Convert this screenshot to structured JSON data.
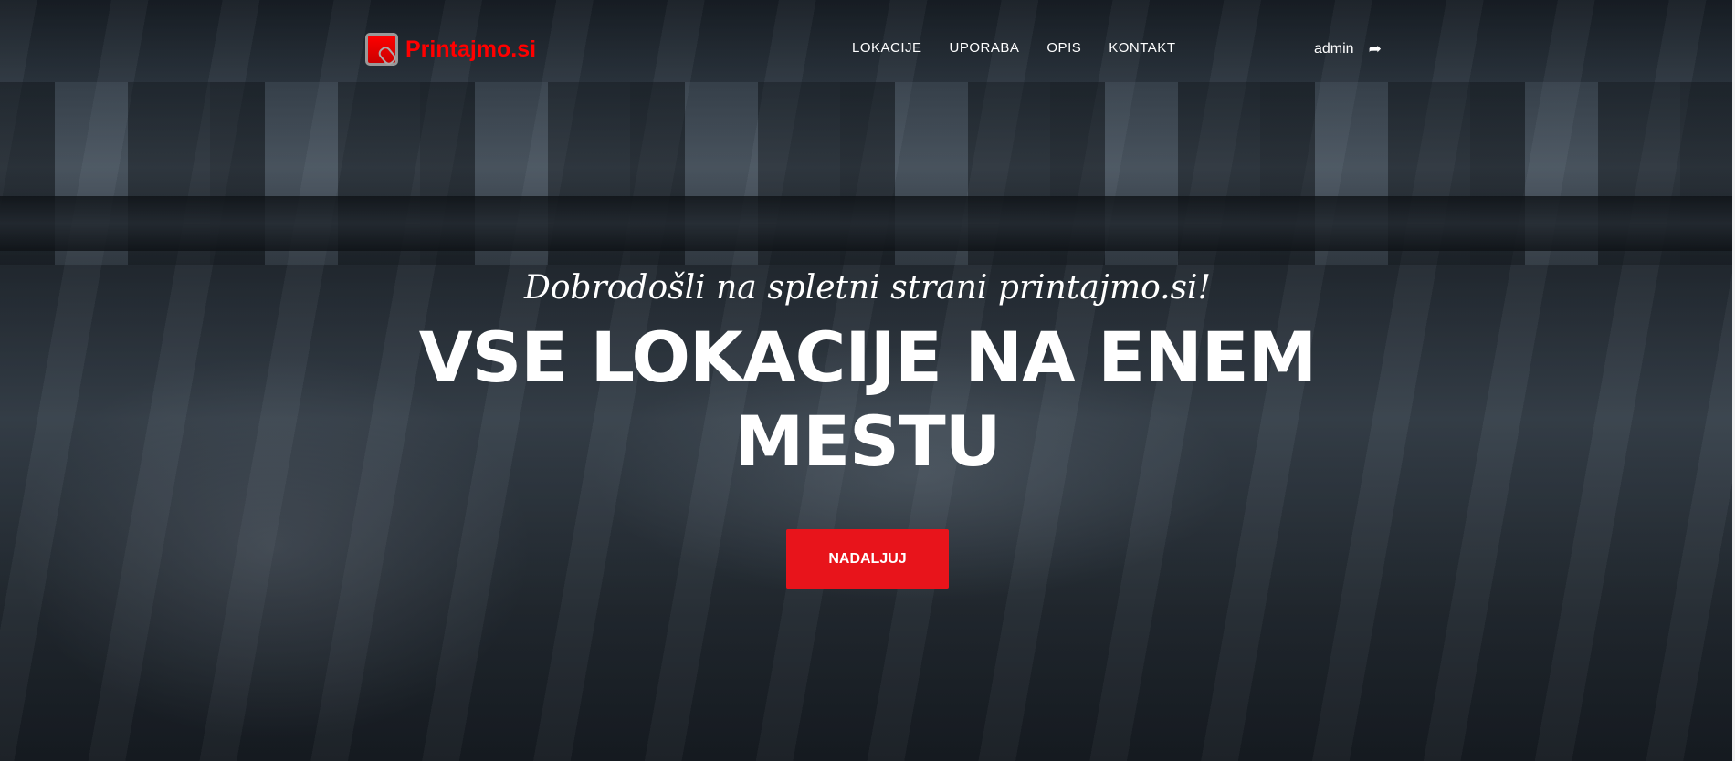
{
  "brand": {
    "name": "Printajmo.si",
    "color": "#ff0000"
  },
  "nav": {
    "items": [
      "LOKACIJE",
      "UPORABA",
      "OPIS",
      "KONTAKT"
    ]
  },
  "user": {
    "name": "admin",
    "logout_icon": "sign-out-icon"
  },
  "hero": {
    "subtitle": "Dobrodošli na spletni strani printajmo.si!",
    "title": "VSE LOKACIJE NA ENEM MESTU",
    "button": "NADALJUJ",
    "button_color": "#e8141b"
  }
}
